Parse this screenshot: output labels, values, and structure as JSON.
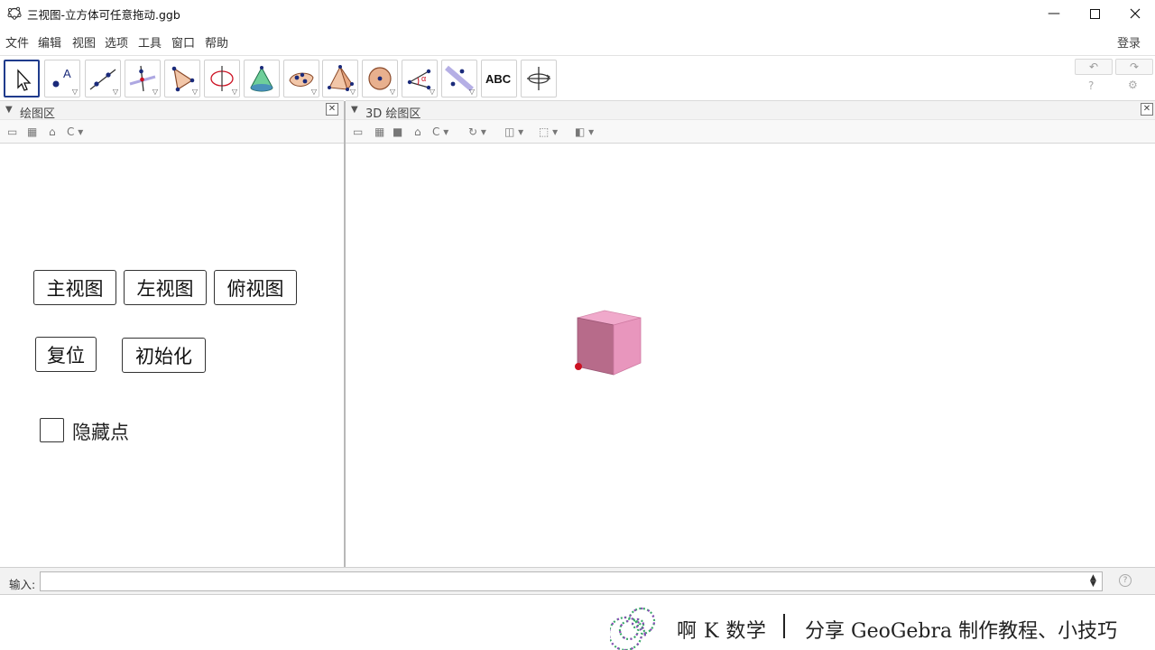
{
  "window": {
    "title": "三视图-立方体可任意拖动.ggb"
  },
  "menu": {
    "items": [
      "文件",
      "编辑",
      "视图",
      "选项",
      "工具",
      "窗口",
      "帮助"
    ],
    "login": "登录"
  },
  "toolbar": {
    "tools": [
      "move-tool",
      "point-tool",
      "line-tool",
      "perpendicular-tool",
      "polygon-tool",
      "circle-axis-tool",
      "cone-tool",
      "intersect-surfaces-tool",
      "pyramid-tool",
      "sphere-tool",
      "angle-tool",
      "reflect-plane-tool",
      "text-tool",
      "rotate-view-tool"
    ],
    "text_tool_label": "ABC",
    "undo": "↶",
    "redo": "↷"
  },
  "graphics_panel": {
    "title": "绘图区"
  },
  "view3d_panel": {
    "title": "3D 绘图区"
  },
  "buttons": {
    "front_view": "主视图",
    "left_view": "左视图",
    "top_view": "俯视图",
    "reset": "复位",
    "initialize": "初始化"
  },
  "checkbox": {
    "label": "隐藏点",
    "checked": false
  },
  "input_bar": {
    "label": "输入:",
    "value": ""
  },
  "banner": {
    "brand": "啊 K 数学",
    "tagline": "分享 GeoGebra 制作教程、小技巧"
  },
  "colors": {
    "cube_front": "#b76b8a",
    "cube_side": "#e896bd",
    "cube_top": "#f0a9cb",
    "point": "#cc1122",
    "selected_tool_border": "#1f3b8c"
  }
}
